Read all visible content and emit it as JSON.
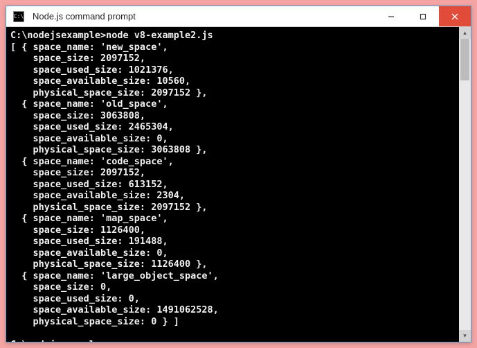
{
  "window": {
    "title": "Node.js command prompt",
    "icon_label": "C:\\"
  },
  "prompt": {
    "path": "C:\\nodejsexample",
    "symbol": ">",
    "command": "node v8-example2.js"
  },
  "output": {
    "spaces": [
      {
        "space_name": "new_space",
        "space_size": 2097152,
        "space_used_size": 1021376,
        "space_available_size": 10560,
        "physical_space_size": 2097152
      },
      {
        "space_name": "old_space",
        "space_size": 3063808,
        "space_used_size": 2465304,
        "space_available_size": 0,
        "physical_space_size": 3063808
      },
      {
        "space_name": "code_space",
        "space_size": 2097152,
        "space_used_size": 613152,
        "space_available_size": 2304,
        "physical_space_size": 2097152
      },
      {
        "space_name": "map_space",
        "space_size": 1126400,
        "space_used_size": 191488,
        "space_available_size": 0,
        "physical_space_size": 1126400
      },
      {
        "space_name": "large_object_space",
        "space_size": 0,
        "space_used_size": 0,
        "space_available_size": 1491062528,
        "physical_space_size": 0
      }
    ]
  }
}
